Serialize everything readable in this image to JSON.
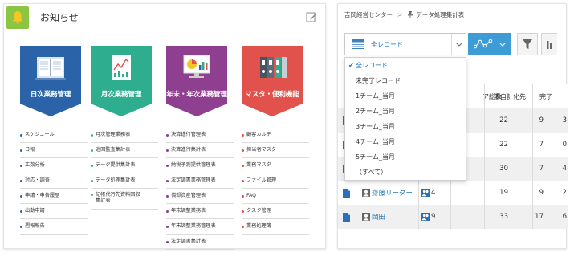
{
  "notice": {
    "title": "お知らせ",
    "header_icon": "bell-icon",
    "edit_icon": "edit-icon"
  },
  "categories": [
    {
      "label": "日次業務管理",
      "color": "#2a63a8",
      "icon": "book-icon",
      "dot_color": "#2a63a8",
      "links": [
        "スケジュール",
        "日報",
        "工数分析",
        "対応・調査",
        "申請・申告履歴",
        "出勤申請",
        "週報報告"
      ]
    },
    {
      "label": "月次業務管理",
      "color": "#2fae8f",
      "icon": "report-chart-icon",
      "dot_color": "#2fae8f",
      "links": [
        "月次管理業務表",
        "巡回監査集計表",
        "データ提供集計表",
        "データ処理集計表",
        "記帳代行先資料回収集計表"
      ]
    },
    {
      "label": "年末・年次業務管理",
      "color": "#8e3f8f",
      "icon": "monitor-chart-icon",
      "dot_color": "#8e3f8f",
      "links": [
        "決算進行管理表",
        "決算進行集計表",
        "納税予測提供管理表",
        "法定調書業務管理表",
        "償却資産管理表",
        "年末調整業務表",
        "年末調整業務管理表",
        "法定調書集計表"
      ]
    },
    {
      "label": "マスタ・便利機能",
      "color": "#e0524b",
      "icon": "binders-icon",
      "dot_color": "#e0524b",
      "links": [
        "顧客カルテ",
        "担当者マスタ",
        "業務マスタ",
        "ファイル管理",
        "FAQ",
        "タスク管理",
        "業務処理簿"
      ]
    }
  ],
  "right": {
    "breadcrumb": [
      "吉岡経営センター",
      ">",
      "データ処理集計表"
    ],
    "view_select": {
      "label": "全レコード",
      "options": [
        "全レコード",
        "未完了レコード",
        "1チーム_当月",
        "2チーム_当月",
        "3チーム_当月",
        "4チーム_当月",
        "5チーム_当月",
        "（すべて）"
      ],
      "selected_index": 0
    },
    "table": {
      "headers": [
        "ア総数",
        "非自計化先",
        "完了"
      ],
      "rows": [
        {
          "name": "",
          "count": "",
          "total": "22",
          "noncomp": "9",
          "done": "3",
          "bg": "#f0f0f0"
        },
        {
          "name": "",
          "count": "",
          "total": "22",
          "noncomp": "7",
          "done": "0",
          "bg": "#ffffff"
        },
        {
          "name": "",
          "count": "",
          "total": "30",
          "noncomp": "7",
          "done": "4",
          "bg": "#f0f0f0"
        },
        {
          "name": "齋藤リーダー",
          "count": "4",
          "total": "19",
          "noncomp": "9",
          "done": "2",
          "bg": "#ffffff"
        },
        {
          "name": "岡田",
          "count": "9",
          "total": "33",
          "noncomp": "17",
          "done": "6",
          "bg": "#f0f0f0"
        }
      ]
    }
  }
}
